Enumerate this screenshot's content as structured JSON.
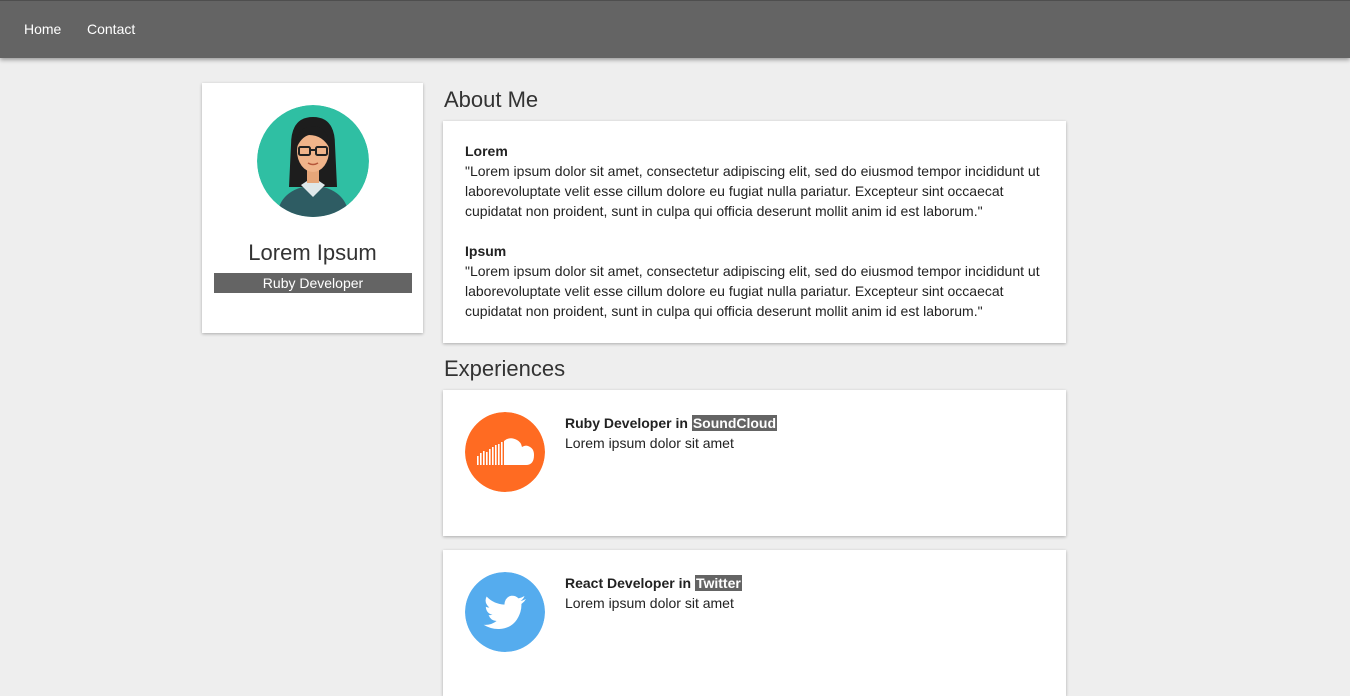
{
  "nav": {
    "items": [
      "Home",
      "Contact"
    ]
  },
  "profile": {
    "name": "Lorem Ipsum",
    "role": "Ruby Developer"
  },
  "about": {
    "title": "About Me",
    "blocks": [
      {
        "heading": "Lorem",
        "text": "\"Lorem ipsum dolor sit amet, consectetur adipiscing elit, sed do eiusmod tempor incididunt ut laborevoluptate velit esse cillum dolore eu fugiat nulla pariatur. Excepteur sint occaecat cupidatat non proident, sunt in culpa qui officia deserunt mollit anim id est laborum.\""
      },
      {
        "heading": "Ipsum",
        "text": "\"Lorem ipsum dolor sit amet, consectetur adipiscing elit, sed do eiusmod tempor incididunt ut laborevoluptate velit esse cillum dolore eu fugiat nulla pariatur. Excepteur sint occaecat cupidatat non proident, sunt in culpa qui officia deserunt mollit anim id est laborum.\""
      }
    ]
  },
  "experiences": {
    "title": "Experiences",
    "items": [
      {
        "role": "Ruby Developer",
        "connector": "in",
        "company": "SoundCloud",
        "description": "Lorem ipsum dolor sit amet",
        "logo_icon": "soundcloud-icon",
        "logo_color": "#ff6b22"
      },
      {
        "role": "React Developer",
        "connector": "in",
        "company": "Twitter",
        "description": "Lorem ipsum dolor sit amet",
        "logo_icon": "twitter-icon",
        "logo_color": "#55acee"
      }
    ]
  },
  "colors": {
    "navbar": "#646464",
    "background": "#eeeeee",
    "badge": "#646464"
  }
}
